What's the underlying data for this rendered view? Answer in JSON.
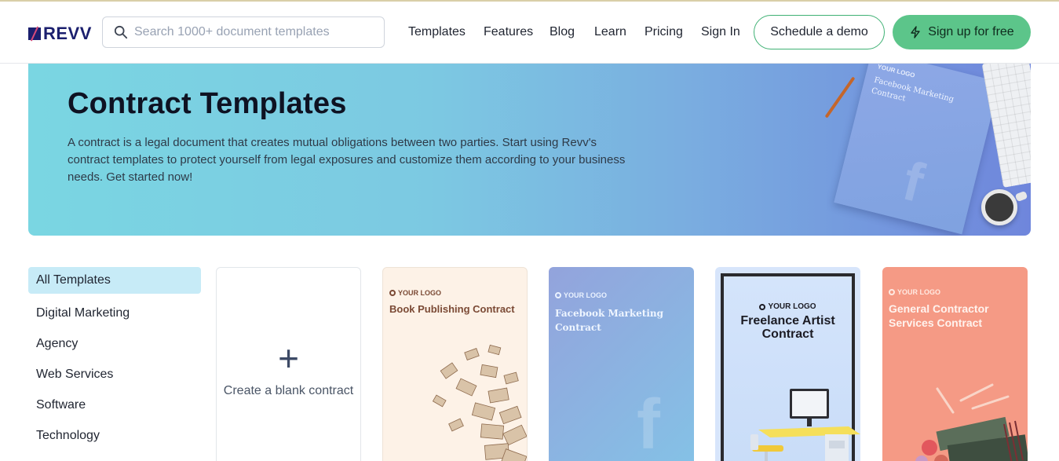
{
  "header": {
    "logo_text": "REVV",
    "search_placeholder": "Search 1000+ document templates",
    "nav": [
      "Templates",
      "Features",
      "Blog",
      "Learn",
      "Pricing",
      "Sign In"
    ],
    "demo_label": "Schedule a demo",
    "signup_label": "Sign up for free"
  },
  "hero": {
    "title": "Contract Templates",
    "description": "A contract is a legal document that creates mutual obligations between two parties. Start using Revv's contract templates to protect yourself from legal exposures and customize them according to your business needs. Get started now!",
    "doc_logo": "YOUR LOGO",
    "doc_title": "Facebook Marketing Contract"
  },
  "sidebar": {
    "items": [
      "All Templates",
      "Digital Marketing",
      "Agency",
      "Web Services",
      "Software",
      "Technology"
    ]
  },
  "cards": {
    "blank_plus": "+",
    "blank_label": "Create a blank contract",
    "logo_label": "YOUR LOGO",
    "book_title": "Book Publishing Contract",
    "fb_title": "Facebook Marketing Contract",
    "freelance_title": "Freelance Artist Contract",
    "general_title": "General Contractor Services Contract"
  },
  "colors": {
    "brand": "#1b1f6e",
    "accent_green": "#5cc58a",
    "active_bg": "#c7ebf7"
  },
  "icons": {
    "search": "search-icon",
    "signup": "lightning-icon",
    "logo": "revv-logo-mark"
  }
}
